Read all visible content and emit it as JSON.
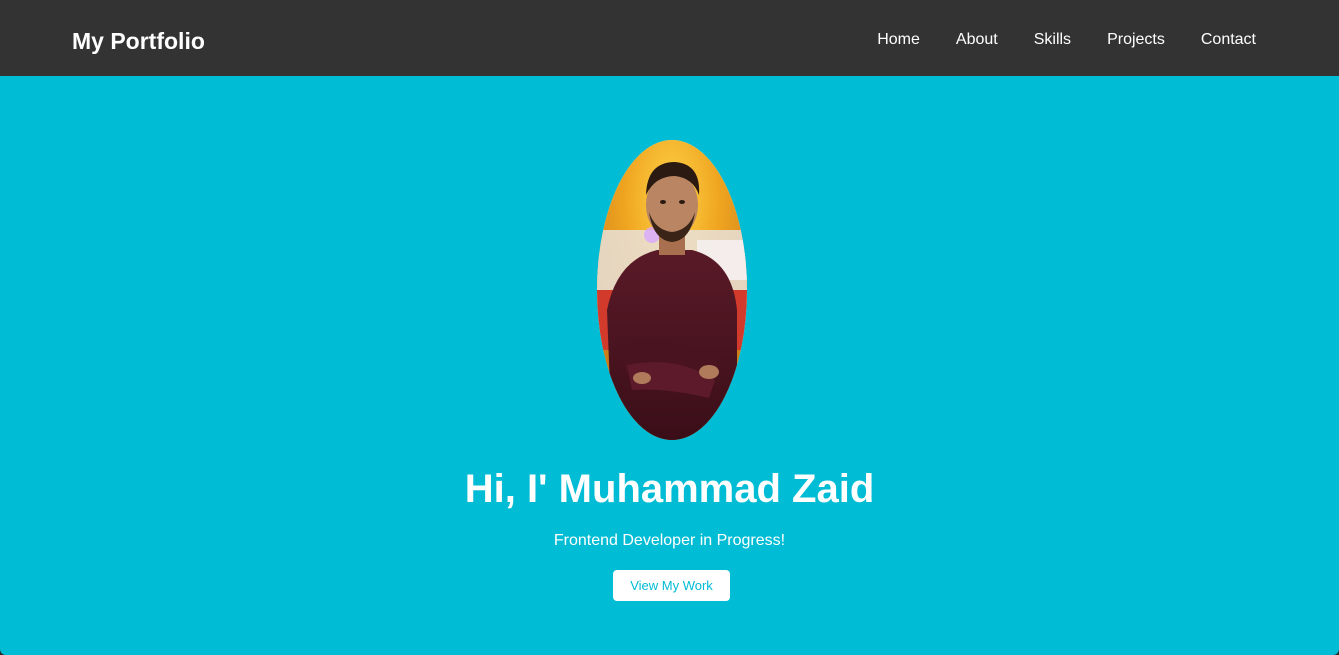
{
  "navbar": {
    "brand": "My Portfolio",
    "links": [
      {
        "label": "Home"
      },
      {
        "label": "About"
      },
      {
        "label": "Skills"
      },
      {
        "label": "Projects"
      },
      {
        "label": "Contact"
      }
    ]
  },
  "hero": {
    "title": "Hi, I' Muhammad Zaid",
    "subtitle": "Frontend Developer in Progress!",
    "cta_label": "View My Work"
  },
  "colors": {
    "navbar_bg": "#333333",
    "hero_bg": "#00bcd4",
    "button_text": "#00bcd4",
    "text": "#ffffff"
  }
}
